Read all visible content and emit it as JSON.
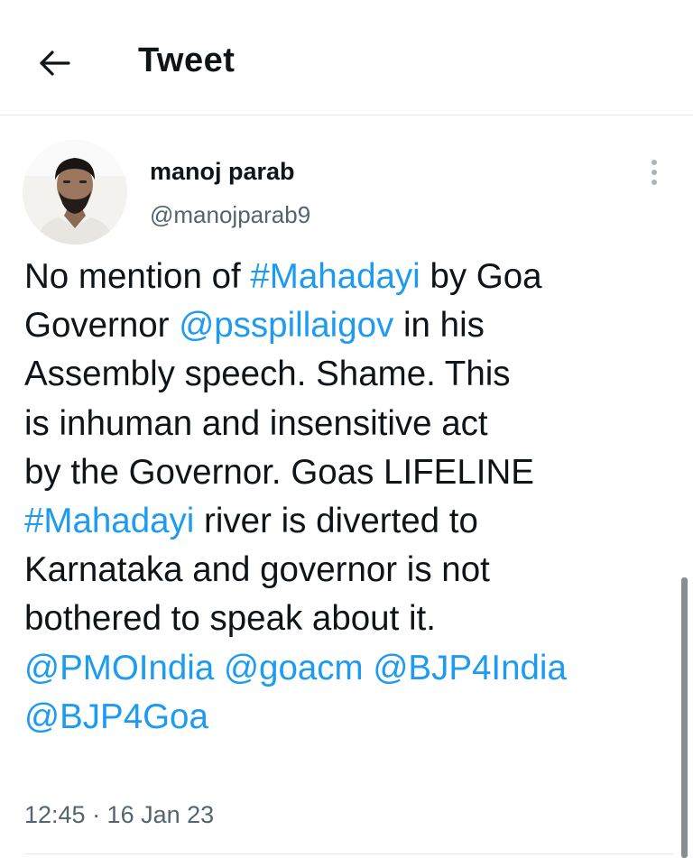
{
  "header": {
    "title": "Tweet"
  },
  "author": {
    "name": "manoj parab",
    "handle": "@manojparab9"
  },
  "tweet": {
    "lines": [
      [
        {
          "t": "No mention of "
        },
        {
          "t": "#Mahadayi",
          "link": true
        },
        {
          "t": " by Goa"
        }
      ],
      [
        {
          "t": "Governor "
        },
        {
          "t": "@psspillaigov",
          "link": true
        },
        {
          "t": " in his"
        }
      ],
      [
        {
          "t": "Assembly speech. Shame. This"
        }
      ],
      [
        {
          "t": "is inhuman and insensitive act"
        }
      ],
      [
        {
          "t": "by the  Governor. Goas LIFELINE"
        }
      ],
      [
        {
          "t": "#Mahadayi",
          "link": true
        },
        {
          "t": " river is diverted to"
        }
      ],
      [
        {
          "t": "Karnataka and governor is not"
        }
      ],
      [
        {
          "t": "bothered to speak about it."
        }
      ],
      [
        {
          "t": "@PMOIndia",
          "link": true
        },
        {
          "t": " "
        },
        {
          "t": "@goacm",
          "link": true
        },
        {
          "t": " "
        },
        {
          "t": "@BJP4India",
          "link": true
        }
      ],
      [
        {
          "t": "@BJP4Goa",
          "link": true
        }
      ]
    ],
    "timestamp": "12:45 · 16 Jan 23"
  },
  "colors": {
    "link": "#1d9bf0",
    "text": "#0f1419",
    "muted": "#536471"
  },
  "icons": {
    "back": "arrow-left-icon",
    "more": "more-vertical-icon"
  }
}
